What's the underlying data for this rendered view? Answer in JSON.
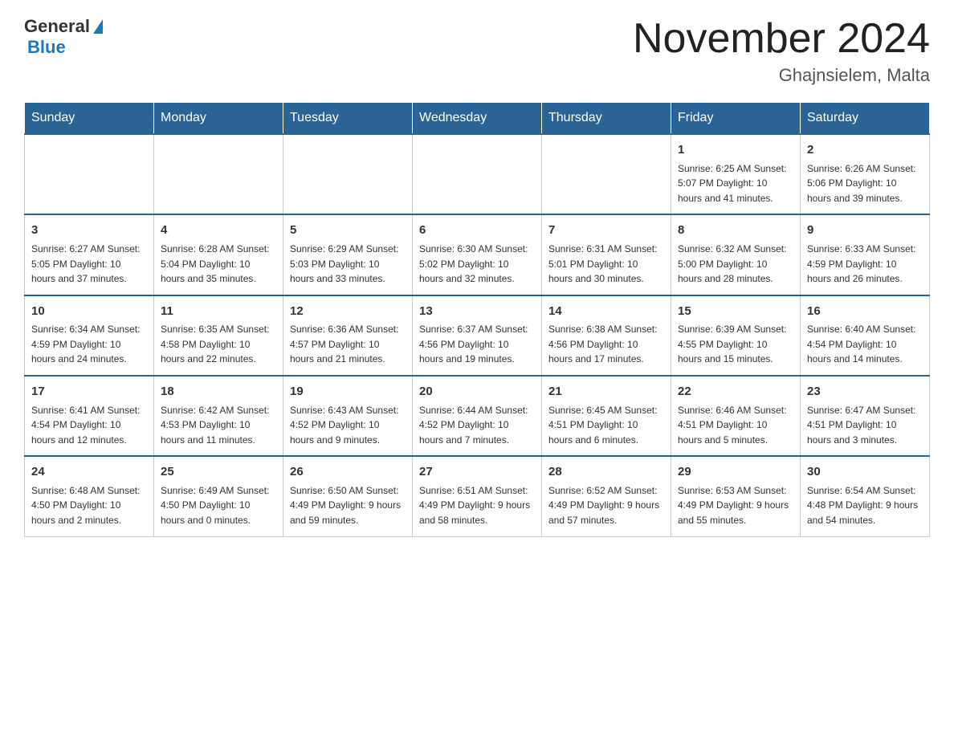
{
  "header": {
    "logo_general": "General",
    "logo_blue": "Blue",
    "month_title": "November 2024",
    "location": "Ghajnsielem, Malta"
  },
  "weekdays": [
    "Sunday",
    "Monday",
    "Tuesday",
    "Wednesday",
    "Thursday",
    "Friday",
    "Saturday"
  ],
  "weeks": [
    [
      {
        "day": "",
        "info": ""
      },
      {
        "day": "",
        "info": ""
      },
      {
        "day": "",
        "info": ""
      },
      {
        "day": "",
        "info": ""
      },
      {
        "day": "",
        "info": ""
      },
      {
        "day": "1",
        "info": "Sunrise: 6:25 AM\nSunset: 5:07 PM\nDaylight: 10 hours and 41 minutes."
      },
      {
        "day": "2",
        "info": "Sunrise: 6:26 AM\nSunset: 5:06 PM\nDaylight: 10 hours and 39 minutes."
      }
    ],
    [
      {
        "day": "3",
        "info": "Sunrise: 6:27 AM\nSunset: 5:05 PM\nDaylight: 10 hours and 37 minutes."
      },
      {
        "day": "4",
        "info": "Sunrise: 6:28 AM\nSunset: 5:04 PM\nDaylight: 10 hours and 35 minutes."
      },
      {
        "day": "5",
        "info": "Sunrise: 6:29 AM\nSunset: 5:03 PM\nDaylight: 10 hours and 33 minutes."
      },
      {
        "day": "6",
        "info": "Sunrise: 6:30 AM\nSunset: 5:02 PM\nDaylight: 10 hours and 32 minutes."
      },
      {
        "day": "7",
        "info": "Sunrise: 6:31 AM\nSunset: 5:01 PM\nDaylight: 10 hours and 30 minutes."
      },
      {
        "day": "8",
        "info": "Sunrise: 6:32 AM\nSunset: 5:00 PM\nDaylight: 10 hours and 28 minutes."
      },
      {
        "day": "9",
        "info": "Sunrise: 6:33 AM\nSunset: 4:59 PM\nDaylight: 10 hours and 26 minutes."
      }
    ],
    [
      {
        "day": "10",
        "info": "Sunrise: 6:34 AM\nSunset: 4:59 PM\nDaylight: 10 hours and 24 minutes."
      },
      {
        "day": "11",
        "info": "Sunrise: 6:35 AM\nSunset: 4:58 PM\nDaylight: 10 hours and 22 minutes."
      },
      {
        "day": "12",
        "info": "Sunrise: 6:36 AM\nSunset: 4:57 PM\nDaylight: 10 hours and 21 minutes."
      },
      {
        "day": "13",
        "info": "Sunrise: 6:37 AM\nSunset: 4:56 PM\nDaylight: 10 hours and 19 minutes."
      },
      {
        "day": "14",
        "info": "Sunrise: 6:38 AM\nSunset: 4:56 PM\nDaylight: 10 hours and 17 minutes."
      },
      {
        "day": "15",
        "info": "Sunrise: 6:39 AM\nSunset: 4:55 PM\nDaylight: 10 hours and 15 minutes."
      },
      {
        "day": "16",
        "info": "Sunrise: 6:40 AM\nSunset: 4:54 PM\nDaylight: 10 hours and 14 minutes."
      }
    ],
    [
      {
        "day": "17",
        "info": "Sunrise: 6:41 AM\nSunset: 4:54 PM\nDaylight: 10 hours and 12 minutes."
      },
      {
        "day": "18",
        "info": "Sunrise: 6:42 AM\nSunset: 4:53 PM\nDaylight: 10 hours and 11 minutes."
      },
      {
        "day": "19",
        "info": "Sunrise: 6:43 AM\nSunset: 4:52 PM\nDaylight: 10 hours and 9 minutes."
      },
      {
        "day": "20",
        "info": "Sunrise: 6:44 AM\nSunset: 4:52 PM\nDaylight: 10 hours and 7 minutes."
      },
      {
        "day": "21",
        "info": "Sunrise: 6:45 AM\nSunset: 4:51 PM\nDaylight: 10 hours and 6 minutes."
      },
      {
        "day": "22",
        "info": "Sunrise: 6:46 AM\nSunset: 4:51 PM\nDaylight: 10 hours and 5 minutes."
      },
      {
        "day": "23",
        "info": "Sunrise: 6:47 AM\nSunset: 4:51 PM\nDaylight: 10 hours and 3 minutes."
      }
    ],
    [
      {
        "day": "24",
        "info": "Sunrise: 6:48 AM\nSunset: 4:50 PM\nDaylight: 10 hours and 2 minutes."
      },
      {
        "day": "25",
        "info": "Sunrise: 6:49 AM\nSunset: 4:50 PM\nDaylight: 10 hours and 0 minutes."
      },
      {
        "day": "26",
        "info": "Sunrise: 6:50 AM\nSunset: 4:49 PM\nDaylight: 9 hours and 59 minutes."
      },
      {
        "day": "27",
        "info": "Sunrise: 6:51 AM\nSunset: 4:49 PM\nDaylight: 9 hours and 58 minutes."
      },
      {
        "day": "28",
        "info": "Sunrise: 6:52 AM\nSunset: 4:49 PM\nDaylight: 9 hours and 57 minutes."
      },
      {
        "day": "29",
        "info": "Sunrise: 6:53 AM\nSunset: 4:49 PM\nDaylight: 9 hours and 55 minutes."
      },
      {
        "day": "30",
        "info": "Sunrise: 6:54 AM\nSunset: 4:48 PM\nDaylight: 9 hours and 54 minutes."
      }
    ]
  ]
}
